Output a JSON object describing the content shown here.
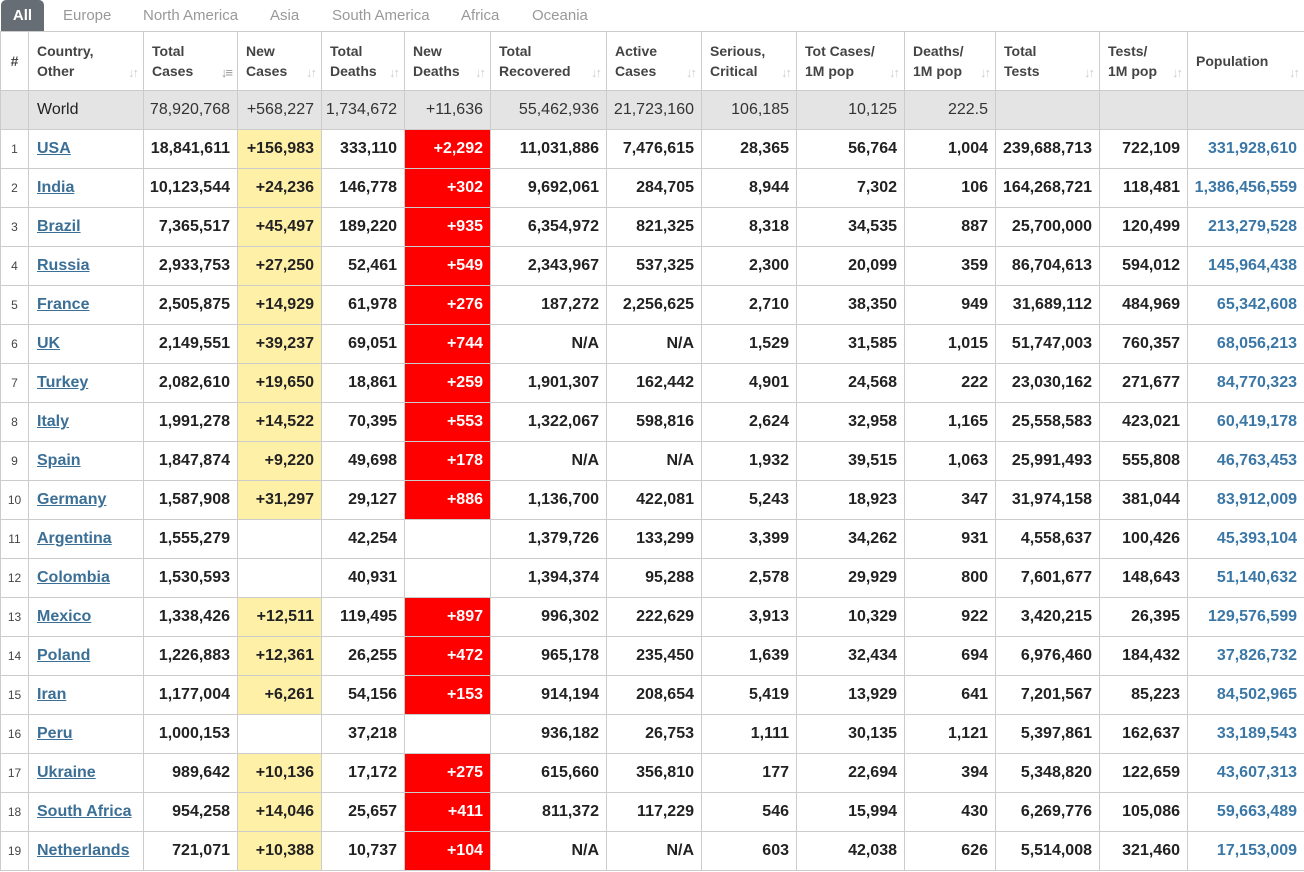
{
  "tabs": [
    "All",
    "Europe",
    "North America",
    "Asia",
    "South America",
    "Africa",
    "Oceania"
  ],
  "headers": {
    "idx": "#",
    "country": [
      "Country,",
      "Other"
    ],
    "total_cases": [
      "Total",
      "Cases"
    ],
    "new_cases": [
      "New",
      "Cases"
    ],
    "total_deaths": [
      "Total",
      "Deaths"
    ],
    "new_deaths": [
      "New",
      "Deaths"
    ],
    "total_recovered": [
      "Total",
      "Recovered"
    ],
    "active_cases": [
      "Active",
      "Cases"
    ],
    "serious": [
      "Serious,",
      "Critical"
    ],
    "cases_per_m": [
      "Tot Cases/",
      "1M pop"
    ],
    "deaths_per_m": [
      "Deaths/",
      "1M pop"
    ],
    "total_tests": [
      "Total",
      "Tests"
    ],
    "tests_per_m": [
      "Tests/",
      "1M pop"
    ],
    "population": [
      "Population",
      ""
    ]
  },
  "world": [
    "",
    "World",
    "78,920,768",
    "+568,227",
    "1,734,672",
    "+11,636",
    "55,462,936",
    "21,723,160",
    "106,185",
    "10,125",
    "222.5",
    "",
    "",
    ""
  ],
  "rows": [
    [
      "1",
      "USA",
      "18,841,611",
      "+156,983",
      "333,110",
      "+2,292",
      "11,031,886",
      "7,476,615",
      "28,365",
      "56,764",
      "1,004",
      "239,688,713",
      "722,109",
      "331,928,610"
    ],
    [
      "2",
      "India",
      "10,123,544",
      "+24,236",
      "146,778",
      "+302",
      "9,692,061",
      "284,705",
      "8,944",
      "7,302",
      "106",
      "164,268,721",
      "118,481",
      "1,386,456,559"
    ],
    [
      "3",
      "Brazil",
      "7,365,517",
      "+45,497",
      "189,220",
      "+935",
      "6,354,972",
      "821,325",
      "8,318",
      "34,535",
      "887",
      "25,700,000",
      "120,499",
      "213,279,528"
    ],
    [
      "4",
      "Russia",
      "2,933,753",
      "+27,250",
      "52,461",
      "+549",
      "2,343,967",
      "537,325",
      "2,300",
      "20,099",
      "359",
      "86,704,613",
      "594,012",
      "145,964,438"
    ],
    [
      "5",
      "France",
      "2,505,875",
      "+14,929",
      "61,978",
      "+276",
      "187,272",
      "2,256,625",
      "2,710",
      "38,350",
      "949",
      "31,689,112",
      "484,969",
      "65,342,608"
    ],
    [
      "6",
      "UK",
      "2,149,551",
      "+39,237",
      "69,051",
      "+744",
      "N/A",
      "N/A",
      "1,529",
      "31,585",
      "1,015",
      "51,747,003",
      "760,357",
      "68,056,213"
    ],
    [
      "7",
      "Turkey",
      "2,082,610",
      "+19,650",
      "18,861",
      "+259",
      "1,901,307",
      "162,442",
      "4,901",
      "24,568",
      "222",
      "23,030,162",
      "271,677",
      "84,770,323"
    ],
    [
      "8",
      "Italy",
      "1,991,278",
      "+14,522",
      "70,395",
      "+553",
      "1,322,067",
      "598,816",
      "2,624",
      "32,958",
      "1,165",
      "25,558,583",
      "423,021",
      "60,419,178"
    ],
    [
      "9",
      "Spain",
      "1,847,874",
      "+9,220",
      "49,698",
      "+178",
      "N/A",
      "N/A",
      "1,932",
      "39,515",
      "1,063",
      "25,991,493",
      "555,808",
      "46,763,453"
    ],
    [
      "10",
      "Germany",
      "1,587,908",
      "+31,297",
      "29,127",
      "+886",
      "1,136,700",
      "422,081",
      "5,243",
      "18,923",
      "347",
      "31,974,158",
      "381,044",
      "83,912,009"
    ],
    [
      "11",
      "Argentina",
      "1,555,279",
      "",
      "42,254",
      "",
      "1,379,726",
      "133,299",
      "3,399",
      "34,262",
      "931",
      "4,558,637",
      "100,426",
      "45,393,104"
    ],
    [
      "12",
      "Colombia",
      "1,530,593",
      "",
      "40,931",
      "",
      "1,394,374",
      "95,288",
      "2,578",
      "29,929",
      "800",
      "7,601,677",
      "148,643",
      "51,140,632"
    ],
    [
      "13",
      "Mexico",
      "1,338,426",
      "+12,511",
      "119,495",
      "+897",
      "996,302",
      "222,629",
      "3,913",
      "10,329",
      "922",
      "3,420,215",
      "26,395",
      "129,576,599"
    ],
    [
      "14",
      "Poland",
      "1,226,883",
      "+12,361",
      "26,255",
      "+472",
      "965,178",
      "235,450",
      "1,639",
      "32,434",
      "694",
      "6,976,460",
      "184,432",
      "37,826,732"
    ],
    [
      "15",
      "Iran",
      "1,177,004",
      "+6,261",
      "54,156",
      "+153",
      "914,194",
      "208,654",
      "5,419",
      "13,929",
      "641",
      "7,201,567",
      "85,223",
      "84,502,965"
    ],
    [
      "16",
      "Peru",
      "1,000,153",
      "",
      "37,218",
      "",
      "936,182",
      "26,753",
      "1,111",
      "30,135",
      "1,121",
      "5,397,861",
      "162,637",
      "33,189,543"
    ],
    [
      "17",
      "Ukraine",
      "989,642",
      "+10,136",
      "17,172",
      "+275",
      "615,660",
      "356,810",
      "177",
      "22,694",
      "394",
      "5,348,820",
      "122,659",
      "43,607,313"
    ],
    [
      "18",
      "South Africa",
      "954,258",
      "+14,046",
      "25,657",
      "+411",
      "811,372",
      "117,229",
      "546",
      "15,994",
      "430",
      "6,269,776",
      "105,086",
      "59,663,489"
    ],
    [
      "19",
      "Netherlands",
      "721,071",
      "+10,388",
      "10,737",
      "+104",
      "N/A",
      "N/A",
      "603",
      "42,038",
      "626",
      "5,514,008",
      "321,460",
      "17,153,009"
    ]
  ],
  "colors": {
    "new_cases_bg": "#fff0a8",
    "new_deaths_bg": "#ff0000",
    "world_bg": "#e4e4e4",
    "link": "#3b6f96",
    "active_tab": "#666d75"
  },
  "icons": {
    "sort": "sort-arrows-icon",
    "sort_active": "sort-desc-icon"
  }
}
